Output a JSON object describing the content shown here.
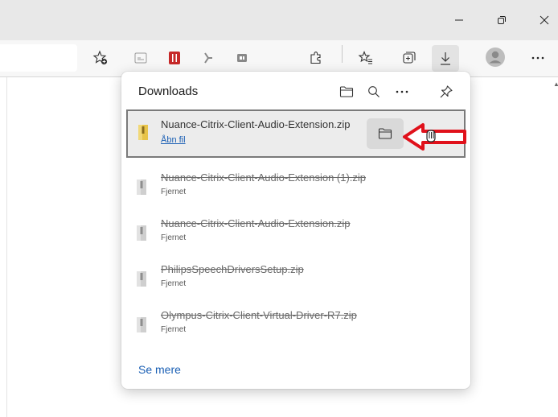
{
  "window": {
    "minimize_icon": "minimize-icon",
    "restore_icon": "restore-icon",
    "close_icon": "close-icon"
  },
  "toolbar": {
    "icons": [
      "favorite-add-icon",
      "reader-icon",
      "office-icon",
      "extension-arrow-icon",
      "tracking-icon",
      "extensions-icon",
      "favorites-icon",
      "collections-icon",
      "downloads-icon",
      "profile-icon",
      "more-icon"
    ]
  },
  "downloads": {
    "title": "Downloads",
    "header_icons": [
      "open-folder-icon",
      "search-icon",
      "more-icon",
      "pin-icon"
    ],
    "items": [
      {
        "name": "Nuance-Citrix-Client-Audio-Extension.zip",
        "action": "Åbn fil",
        "state": "active"
      },
      {
        "name": "Nuance-Citrix-Client-Audio-Extension (1).zip",
        "status": "Fjernet",
        "state": "removed"
      },
      {
        "name": "Nuance-Citrix-Client-Audio-Extension.zip",
        "status": "Fjernet",
        "state": "removed"
      },
      {
        "name": "PhilipsSpeechDriversSetup.zip",
        "status": "Fjernet",
        "state": "removed"
      },
      {
        "name": "Olympus-Citrix-Client-Virtual-Driver-R7.zip",
        "status": "Fjernet",
        "state": "removed"
      }
    ],
    "see_more": "Se mere"
  },
  "colors": {
    "accent": "#1a5fb4",
    "annotation_arrow": "#e0111b"
  }
}
